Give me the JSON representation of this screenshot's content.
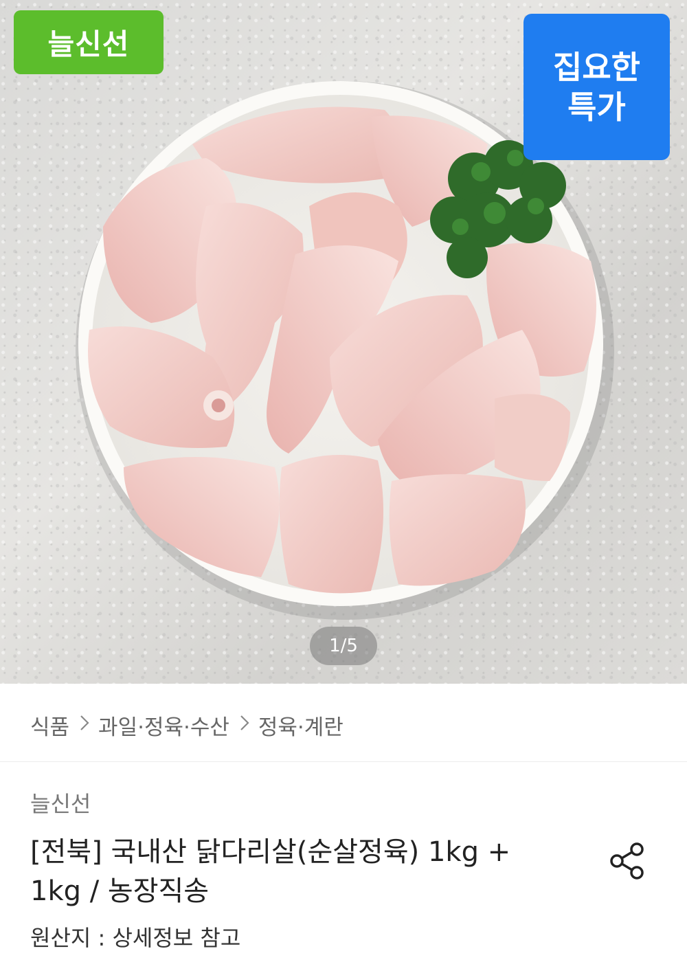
{
  "product_image": {
    "badge_brand": "늘신선",
    "badge_sale_line1": "집요한",
    "badge_sale_line2": "특가",
    "pager": "1/5",
    "colors": {
      "brand_green": "#5cbd2c",
      "sale_blue": "#1f7df0"
    }
  },
  "breadcrumb": {
    "items": [
      "식품",
      "과일·정육·수산",
      "정육·계란"
    ]
  },
  "product": {
    "brand": "늘신선",
    "title_line1": "[전북] 국내산 닭다리살(순살정육) 1kg +",
    "title_line2": "1kg / 농장직송",
    "origin": "원산지 : 상세정보 참고",
    "share_icon": "share-icon"
  }
}
